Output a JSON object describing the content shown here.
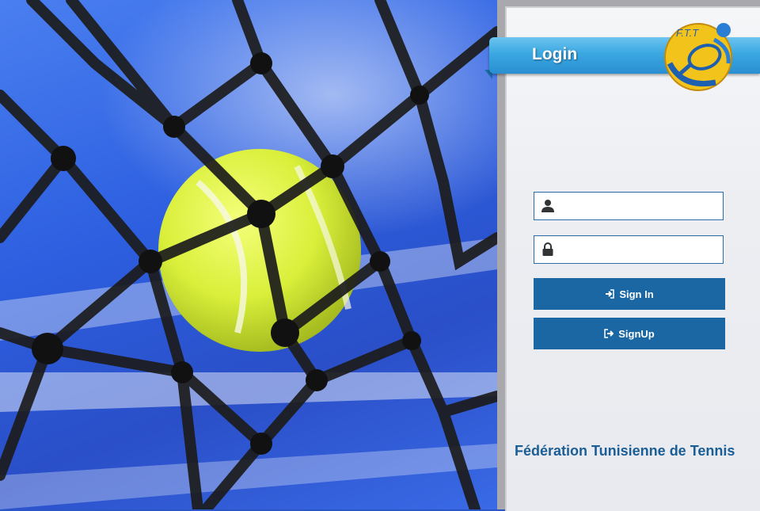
{
  "banner": {
    "title": "Login"
  },
  "logo": {
    "text": "F.T.T"
  },
  "form": {
    "username_placeholder": "",
    "password_placeholder": "",
    "signin_label": "Sign In",
    "signup_label": "SignUp"
  },
  "footer": {
    "federation_name": "Fédération Tunisienne de Tennis"
  },
  "colors": {
    "banner": "#3aa7e2",
    "button": "#1a67a3",
    "footer_text": "#1b5d95",
    "field_border": "#2f6fa9"
  },
  "icons": {
    "username": "user-icon",
    "password": "lock-icon",
    "signin": "sign-in-icon",
    "signup": "sign-out-icon"
  }
}
